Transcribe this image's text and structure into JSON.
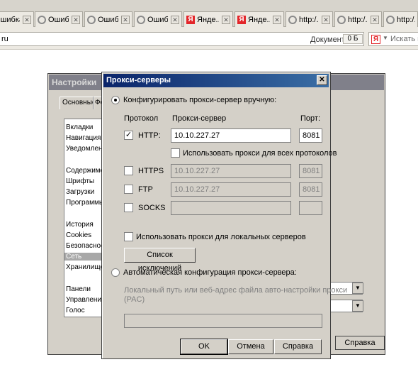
{
  "browser": {
    "tabs": [
      {
        "label": "Ошибка",
        "icon": "loading-circle-icon"
      },
      {
        "label": "Ошибка",
        "icon": "loading-circle-icon"
      },
      {
        "label": "Ошибка",
        "icon": "loading-circle-icon"
      },
      {
        "label": "Ошибка",
        "icon": "loading-circle-icon"
      },
      {
        "label": "Янде...",
        "icon": "yandex-icon"
      },
      {
        "label": "Янде...",
        "icon": "yandex-icon"
      },
      {
        "label": "http:/...",
        "icon": "loading-circle-icon"
      },
      {
        "label": "http:/...",
        "icon": "loading-circle-icon"
      },
      {
        "label": "http:/...",
        "icon": "loading-circle-icon"
      }
    ],
    "url_text": "ru",
    "document_label": "Документ:",
    "document_size": "0 Б",
    "search_logo": "Я",
    "search_placeholder": "Искать в"
  },
  "settings": {
    "title": "Настройки",
    "tabs": [
      "Основные",
      "Фо"
    ],
    "list_items": [
      "Вкладки",
      "Навигация",
      "Уведомлени",
      "Содержимое",
      "Шрифты",
      "Загрузки",
      "Программы",
      "История",
      "Cookies",
      "Безопасност",
      "Сеть",
      "Хранилище",
      "Панели",
      "Управление",
      "Голос"
    ],
    "help_label": "Справка"
  },
  "proxy_dialog": {
    "title": "Прокси-серверы",
    "close_glyph": "✕",
    "manual_label": "Конфигурировать прокси-сервер вручную:",
    "col_protocol": "Протокол",
    "col_server": "Прокси-сервер",
    "col_port": "Порт:",
    "rows": [
      {
        "protocol": "HTTP:",
        "server": "10.10.227.27",
        "port": "8081",
        "checked": true,
        "enabled": true
      },
      {
        "protocol": "HTTPS",
        "server": "10.10.227.27",
        "port": "8081",
        "checked": false,
        "enabled": false
      },
      {
        "protocol": "FTP",
        "server": "10.10.227.27",
        "port": "8081",
        "checked": false,
        "enabled": false
      },
      {
        "protocol": "SOCKS",
        "server": "",
        "port": "",
        "checked": false,
        "enabled": false
      }
    ],
    "use_for_all_label": "Использовать прокси для всех протоколов",
    "use_for_local_label": "Использовать прокси для локальных серверов",
    "exceptions_button": "Список исключений",
    "auto_label": "Автоматическая конфигурация прокси-сервера:",
    "pac_hint": "Локальный путь или веб-адрес файла авто-настройки прокси (PAC)",
    "pac_value": "",
    "ok_label": "OK",
    "cancel_label": "Отмена",
    "help_label": "Справка"
  }
}
